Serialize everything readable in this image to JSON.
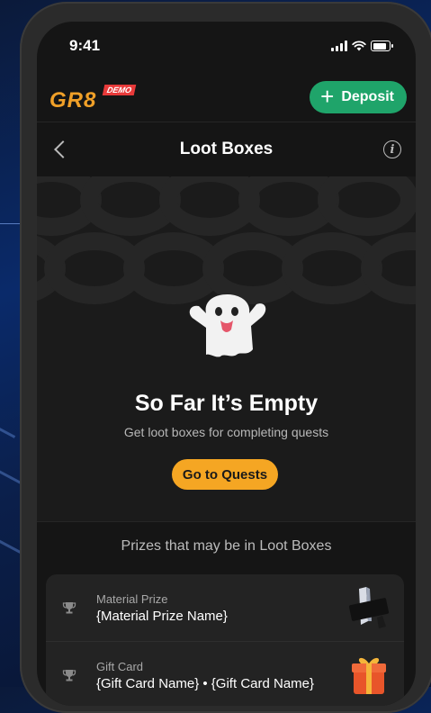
{
  "status_bar": {
    "time": "9:41"
  },
  "header": {
    "logo_text": "GR8",
    "demo_badge": "DEMO",
    "deposit_label": "Deposit"
  },
  "nav": {
    "title": "Loot Boxes"
  },
  "empty_state": {
    "title": "So Far It’s Empty",
    "subtitle": "Get loot boxes for completing quests",
    "cta_label": "Go to Quests"
  },
  "prizes": {
    "heading": "Prizes that may be in Loot Boxes",
    "items": [
      {
        "category": "Material Prize",
        "name": "{Material Prize Name}",
        "thumb": "playstation-5-icon"
      },
      {
        "category": "Gift Card",
        "name": "{Gift Card Name} • {Gift Card Name}",
        "thumb": "gift-box-icon"
      }
    ]
  },
  "colors": {
    "accent_orange": "#f5a623",
    "deposit_green": "#1fa46a",
    "demo_red": "#e83a3a",
    "background": "#151515"
  }
}
